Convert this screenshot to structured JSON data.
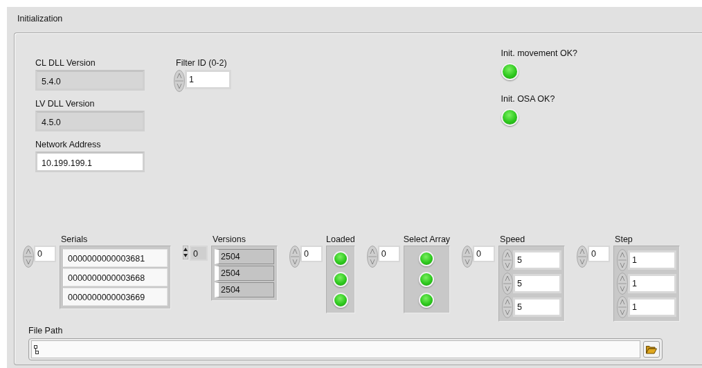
{
  "title": "Initialization",
  "indicators": [
    {
      "label": "CL DLL Version",
      "value": "5.4.0",
      "kind": "indicator"
    },
    {
      "label": "LV DLL Version",
      "value": "4.5.0",
      "kind": "indicator"
    },
    {
      "label": "Network Address",
      "value": "10.199.199.1",
      "kind": "control"
    }
  ],
  "filter_id": {
    "label": "Filter ID (0-2)",
    "value": "1"
  },
  "leds": [
    {
      "label": "Init. movement OK?",
      "on": true
    },
    {
      "label": "Init. OSA OK?",
      "on": true
    }
  ],
  "arrays": [
    {
      "label": "Serials",
      "index": "0",
      "kind": "string",
      "elements": [
        {
          "value": "0000000000003681"
        },
        {
          "value": "0000000000003668"
        },
        {
          "value": "0000000000003669"
        }
      ]
    },
    {
      "label": "Versions",
      "index": "0",
      "kind": "indicator",
      "elements": [
        {
          "value": "2504"
        },
        {
          "value": "2504"
        },
        {
          "value": "2504"
        }
      ]
    },
    {
      "label": "Loaded",
      "index": "0",
      "kind": "led",
      "elements": [
        {
          "on": true
        },
        {
          "on": true
        },
        {
          "on": true
        }
      ]
    },
    {
      "label": "Select Array",
      "index": "0",
      "kind": "led",
      "elements": [
        {
          "on": true
        },
        {
          "on": true
        },
        {
          "on": true
        }
      ]
    },
    {
      "label": "Speed",
      "index": "0",
      "kind": "numeric",
      "elements": [
        {
          "value": "5"
        },
        {
          "value": "5"
        },
        {
          "value": "5"
        }
      ]
    },
    {
      "label": "Step",
      "index": "0",
      "kind": "numeric",
      "elements": [
        {
          "value": "1"
        },
        {
          "value": "1"
        },
        {
          "value": "1"
        }
      ]
    }
  ],
  "file_path": {
    "label": "File Path"
  }
}
